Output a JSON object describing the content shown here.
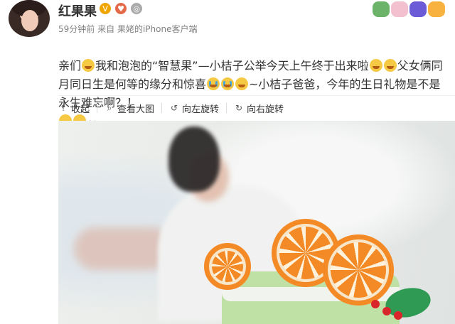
{
  "user": {
    "name": "红果果",
    "avatar_icon": "user-avatar"
  },
  "meta": {
    "time": "59分钟前",
    "source_prefix": "来自",
    "source": "果姥的iPhone客户端"
  },
  "post": {
    "text_lines": [
      "亲们",
      "我和泡泡的“智慧果”—小桔子公举今天上午终于出来啦",
      "父女俩同月同日生是何等的缘分和惊喜",
      "~小桔子爸爸，今年的生日礼物是不是永生难忘啊？！",
      "~"
    ]
  },
  "toolbar": {
    "collapse_label": "收起",
    "view_large_label": "查看大图",
    "rotate_left_label": "向左旋转",
    "rotate_right_label": "向右旋转"
  },
  "icons": {
    "collapse": "arrow-up-icon",
    "view_large": "magnifier-icon",
    "rotate_left": "rotate-left-icon",
    "rotate_right": "rotate-right-icon"
  },
  "colors": {
    "accent_orange": "#F48A26",
    "cake_green": "#BFE1A6"
  }
}
